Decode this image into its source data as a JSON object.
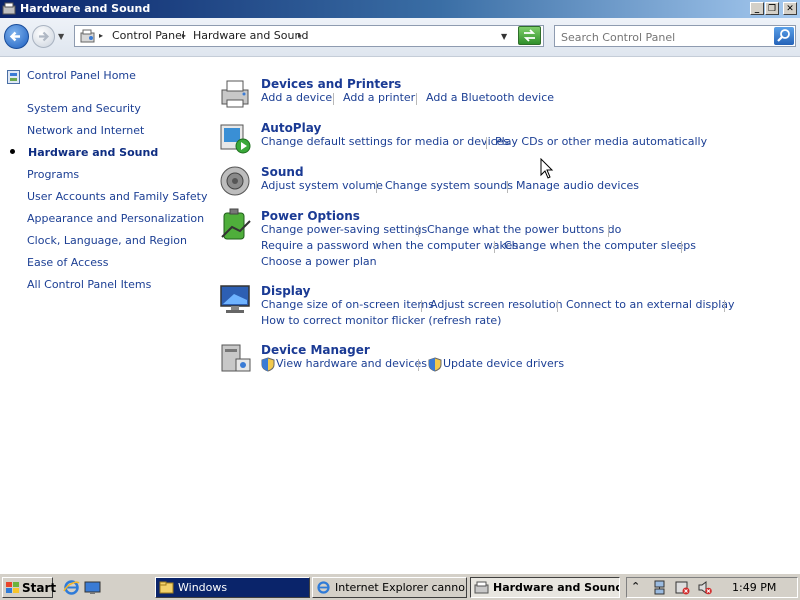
{
  "window": {
    "title": "Hardware and Sound"
  },
  "address_bar": {
    "breadcrumbs": [
      "Control Panel",
      "Hardware and Sound"
    ],
    "search_placeholder": "Search Control Panel"
  },
  "sidebar": {
    "home": "Control Panel Home",
    "items": [
      "System and Security",
      "Network and Internet",
      "Hardware and Sound",
      "Programs",
      "User Accounts and Family Safety",
      "Appearance and Personalization",
      "Clock, Language, and Region",
      "Ease of Access",
      "All Control Panel Items"
    ],
    "current": "Hardware and Sound"
  },
  "categories": [
    {
      "title": "Devices and Printers",
      "icon": "devices-printers-icon",
      "links": [
        "Add a device",
        "Add a printer",
        "Add a Bluetooth device"
      ]
    },
    {
      "title": "AutoPlay",
      "icon": "autoplay-icon",
      "links": [
        "Change default settings for media or devices",
        "Play CDs or other media automatically"
      ]
    },
    {
      "title": "Sound",
      "icon": "speaker-icon",
      "links": [
        "Adjust system volume",
        "Change system sounds",
        "Manage audio devices"
      ]
    },
    {
      "title": "Power Options",
      "icon": "battery-icon",
      "links": [
        "Change power-saving settings",
        "Change what the power buttons do",
        "Require a password when the computer wakes",
        "Change when the computer sleeps",
        "Choose a power plan"
      ]
    },
    {
      "title": "Display",
      "icon": "monitor-icon",
      "links": [
        "Change size of on-screen items",
        "Adjust screen resolution",
        "Connect to an external display",
        "How to correct monitor flicker (refresh rate)"
      ]
    },
    {
      "title": "Device Manager",
      "icon": "device-manager-icon",
      "links": [
        "View hardware and devices",
        "Update device drivers"
      ]
    }
  ],
  "taskbar": {
    "start": "Start",
    "buttons": [
      "Windows",
      "Internet Explorer canno...",
      "Hardware and Sound"
    ],
    "clock": "1:49 PM"
  }
}
